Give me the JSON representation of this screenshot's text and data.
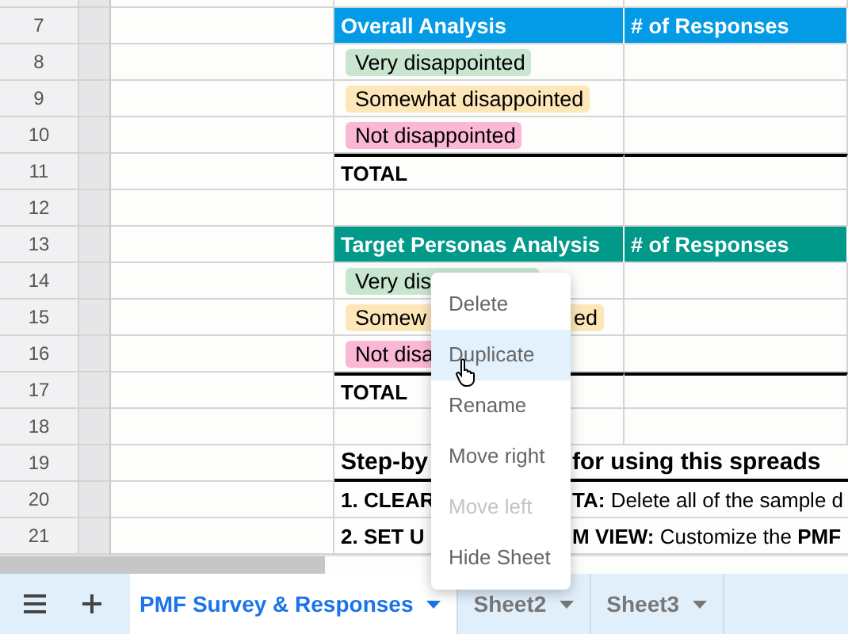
{
  "row_numbers": [
    "7",
    "8",
    "9",
    "10",
    "11",
    "12",
    "13",
    "14",
    "15",
    "16",
    "17",
    "18",
    "19",
    "20",
    "21"
  ],
  "tables": [
    {
      "title": "Overall Analysis",
      "column_2": "# of Responses",
      "color": "#039be5",
      "total": "TOTAL",
      "options": [
        {
          "label": "Very disappointed",
          "color": "#c8e6cf"
        },
        {
          "label": "Somewhat disappointed",
          "color": "#fde7b9"
        },
        {
          "label": "Not disappointed",
          "color": "#fbb7d3"
        }
      ]
    },
    {
      "title": "Target Personas Analysis",
      "column_2": "# of Responses",
      "color": "#00998a",
      "total": "TOTAL",
      "options": [
        {
          "label": "Very dis",
          "color": "#c8e6cf"
        },
        {
          "label": "Somew",
          "label_end": "ed",
          "color": "#fde7b9"
        },
        {
          "label": "Not disa",
          "color": "#fbb7d3"
        }
      ]
    }
  ],
  "instructions": {
    "heading_start": "Step-by",
    "heading_end": "for using this spreads",
    "steps": [
      {
        "start": "1. CLEAR",
        "end": "**TA:** Delete all of the sample d"
      },
      {
        "start": "2. SET U",
        "end": "**M VIEW:** Customize the **PMF**"
      }
    ]
  },
  "context_menu": [
    {
      "label": "Delete",
      "hovered": false,
      "disabled": false
    },
    {
      "label": "Duplicate",
      "hovered": true,
      "disabled": false
    },
    {
      "label": "Rename",
      "hovered": false,
      "disabled": false
    },
    {
      "label": "Move right",
      "hovered": false,
      "disabled": false
    },
    {
      "label": "Move left",
      "hovered": false,
      "disabled": true
    },
    {
      "label": "Hide Sheet",
      "hovered": false,
      "disabled": false
    }
  ],
  "tabs": [
    {
      "label": "PMF Survey & Responses",
      "selected": true
    },
    {
      "label": "Sheet2",
      "selected": false
    },
    {
      "label": "Sheet3",
      "selected": false
    }
  ]
}
